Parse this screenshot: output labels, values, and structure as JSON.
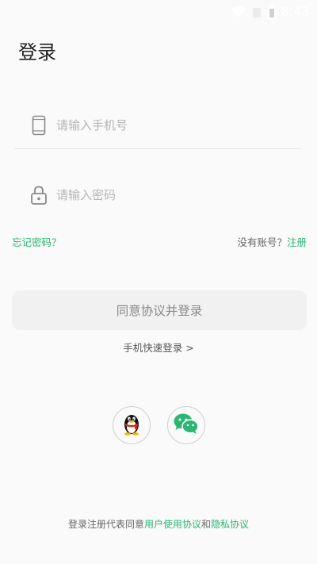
{
  "status_bar": {
    "time": "8:43",
    "icons": [
      "wifi-icon",
      "signal-icon",
      "battery-icon"
    ]
  },
  "page": {
    "title": "登录"
  },
  "phone_field": {
    "placeholder": "请输入手机号",
    "icon": "phone-icon"
  },
  "password_field": {
    "placeholder": "请输入密码",
    "icon": "lock-icon"
  },
  "links": {
    "forgot_password": "忘记密码？",
    "no_account": "没有账号？",
    "register": "注册"
  },
  "login_button": {
    "label": "同意协议并登录"
  },
  "quick_login": {
    "label": "手机快速登录 >"
  },
  "social_login": [
    {
      "name": "QQ",
      "icon": "qq-penguin-icon"
    },
    {
      "name": "WeChat",
      "icon": "wechat-icon"
    }
  ],
  "agreement": {
    "prefix": "登录注册代表同意",
    "user_agreement": "用户使用协议",
    "and": "和",
    "privacy_policy": "隐私协议"
  },
  "colors": {
    "accent": "#2bb673",
    "background": "#fafafa",
    "button_bg": "#f1f1f1"
  }
}
